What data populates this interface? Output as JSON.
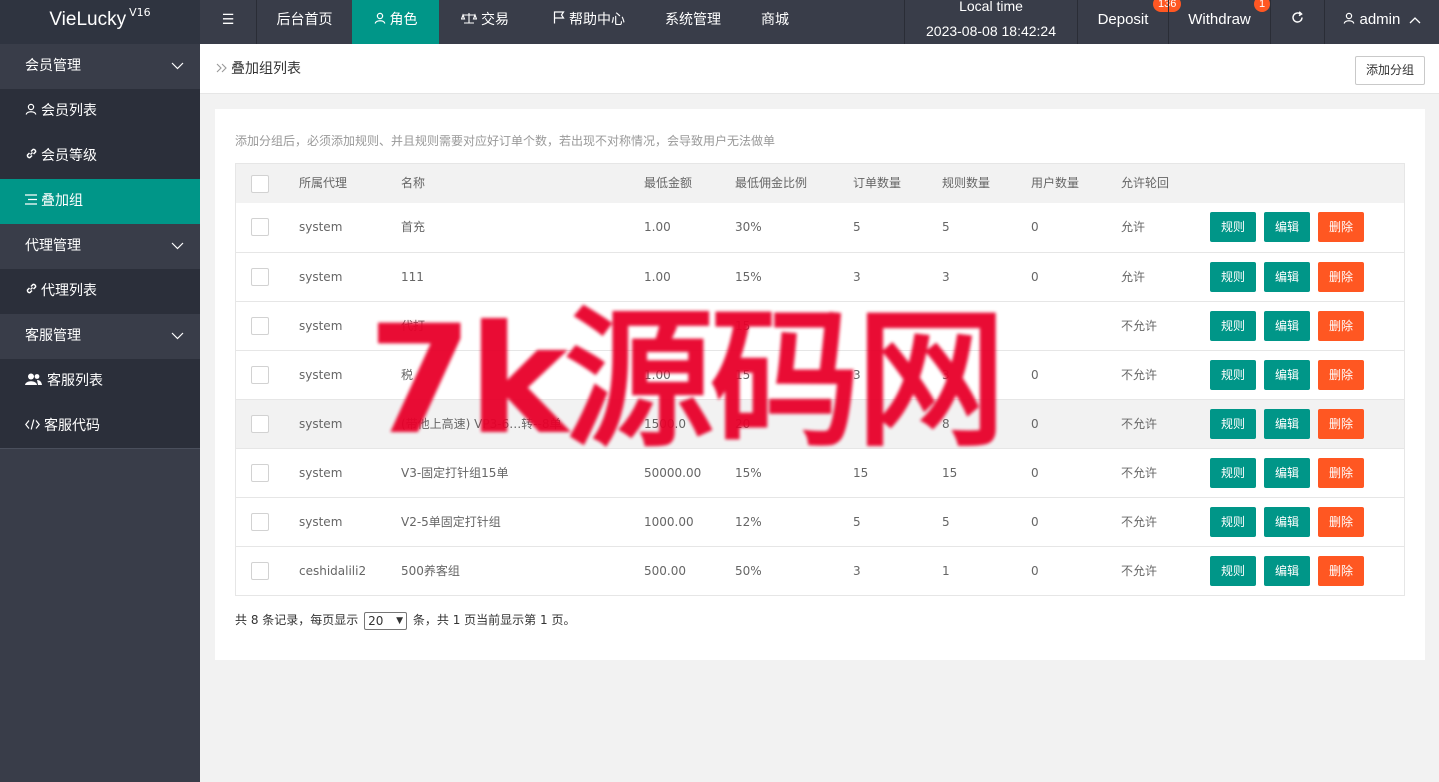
{
  "app": {
    "name": "VieLucky",
    "version": "V16"
  },
  "topnav": {
    "menu_toggle_icon": "menu-icon",
    "items": [
      {
        "label": "后台首页",
        "icon": ""
      },
      {
        "label": "角色",
        "icon": "user-icon"
      },
      {
        "label": "交易",
        "icon": "scale-icon"
      },
      {
        "label": "帮助中心",
        "icon": "flag-icon"
      },
      {
        "label": "系统管理",
        "icon": ""
      },
      {
        "label": "商城",
        "icon": ""
      }
    ],
    "local_time_label": "Local time",
    "local_time_value": "2023-08-08 18:42:24",
    "deposit_label": "Deposit",
    "deposit_badge": "136",
    "withdraw_label": "Withdraw",
    "withdraw_badge": "1",
    "refresh_icon": "refresh-icon",
    "user_label": "admin"
  },
  "sidebar": {
    "items": [
      {
        "label": "会员管理",
        "type": "group"
      },
      {
        "label": "会员列表",
        "type": "sub",
        "icon": "user-icon"
      },
      {
        "label": "会员等级",
        "type": "sub",
        "icon": "link-icon"
      },
      {
        "label": "叠加组",
        "type": "sub",
        "icon": "list-icon",
        "active": true
      },
      {
        "label": "代理管理",
        "type": "group"
      },
      {
        "label": "代理列表",
        "type": "sub",
        "icon": "link-icon"
      },
      {
        "label": "客服管理",
        "type": "group"
      },
      {
        "label": "客服列表",
        "type": "sub",
        "icon": "users-icon"
      },
      {
        "label": "客服代码",
        "type": "sub",
        "icon": "code-icon"
      }
    ]
  },
  "header": {
    "breadcrumb": "叠加组列表",
    "add_button": "添加分组"
  },
  "notice": "添加分组后，必须添加规则、并且规则需要对应好订单个数，若出现不对称情况，会导致用户无法做单",
  "table": {
    "columns": [
      "所属代理",
      "名称",
      "最低金额",
      "最低佣金比例",
      "订单数量",
      "规则数量",
      "用户数量",
      "允许轮回"
    ],
    "actions": {
      "rules": "规则",
      "edit": "编辑",
      "delete": "删除"
    },
    "rows": [
      [
        "system",
        "首充",
        "1.00",
        "30%",
        "5",
        "5",
        "0",
        "允许"
      ],
      [
        "system",
        "111",
        "1.00",
        "15%",
        "3",
        "3",
        "0",
        "允许"
      ],
      [
        "system",
        "代打",
        "",
        "15",
        "",
        "",
        "",
        "不允许"
      ],
      [
        "system",
        "税",
        "1.00",
        "15",
        "3",
        "3",
        "0",
        "不允许"
      ],
      [
        "system",
        "(带他上高速) VP3-6…转--8单",
        "1500.0",
        "20",
        "",
        "8",
        "0",
        "不允许"
      ],
      [
        "system",
        "V3-固定打针组15单",
        "50000.00",
        "15%",
        "15",
        "15",
        "0",
        "不允许"
      ],
      [
        "system",
        "V2-5单固定打针组",
        "1000.00",
        "12%",
        "5",
        "5",
        "0",
        "不允许"
      ],
      [
        "ceshidalili2",
        "500养客组",
        "500.00",
        "50%",
        "3",
        "1",
        "0",
        "不允许"
      ]
    ]
  },
  "pagination": {
    "prefix": "共 8 条记录，每页显示",
    "page_size": "20",
    "suffix": "条，共 1 页当前显示第 1 页。"
  },
  "watermark": "7k源码网"
}
